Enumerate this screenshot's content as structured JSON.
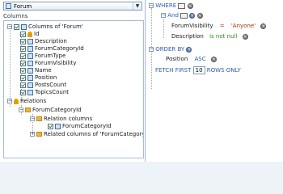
{
  "entity_selector": {
    "value": "Forum",
    "icon": "entity-icon"
  },
  "columns_label": "Columns",
  "tree": {
    "root_label": "Columns of 'Forum'",
    "columns": [
      "Id",
      "Description",
      "ForumCategoryId",
      "ForumType",
      "ForumVisibility",
      "Name",
      "Position",
      "PostsCount",
      "TopicsCount"
    ],
    "relations_label": "Relations",
    "relation_name": "ForumCategoryId",
    "relation_columns_label": "Relation columns",
    "relation_column": "ForumCategoryId",
    "related_columns_label": "Related columns of 'ForumCategory'"
  },
  "query": {
    "where_kw": "WHERE",
    "and_kw": "And",
    "cond1": {
      "field": "ForumVisibility",
      "op": "=",
      "value": "'Anyone'"
    },
    "cond2": {
      "field": "Description",
      "op": "is not null"
    },
    "order_by_kw": "ORDER BY",
    "order_field": "Position",
    "order_dir": "ASC",
    "fetch_first_kw": "FETCH FIRST",
    "fetch_count": "10",
    "rows_only_kw": "ROWS ONLY"
  },
  "colors": {
    "keyword": "#2a5db0",
    "operator": "#b03000",
    "not_null": "#2a8a2a"
  }
}
